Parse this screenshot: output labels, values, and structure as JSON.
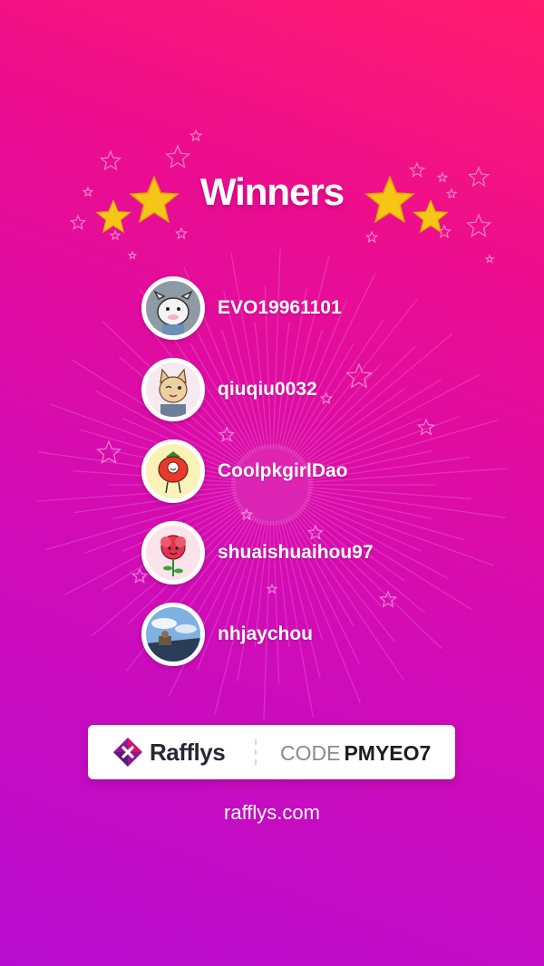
{
  "header": {
    "title": "Winners",
    "star_color": "#f5c518"
  },
  "winners": [
    {
      "username": "EVO19961101",
      "avatar": "cartoon-cow-avatar"
    },
    {
      "username": "qiuqiu0032",
      "avatar": "winking-cat-avatar"
    },
    {
      "username": "CoolpkgirlDao",
      "avatar": "tomato-character-avatar"
    },
    {
      "username": "shuaishuaihou97",
      "avatar": "red-flower-avatar"
    },
    {
      "username": "nhjaychou",
      "avatar": "sky-photo-avatar"
    }
  ],
  "footer": {
    "brand_name": "Rafflys",
    "code_label": "CODE",
    "code_value": "PMYEO7",
    "website": "rafflys.com"
  },
  "colors": {
    "background_start": "#b70cd0",
    "background_end": "#ff1c6c",
    "brand_accent": "#d4136f"
  }
}
